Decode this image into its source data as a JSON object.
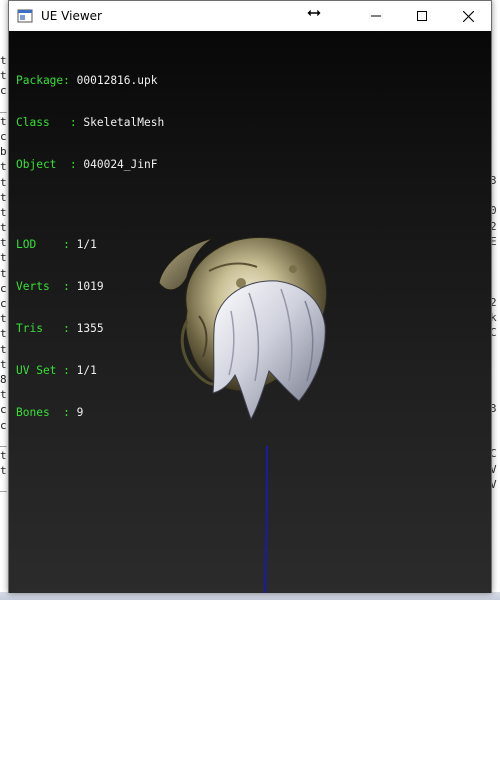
{
  "window": {
    "title": "UE Viewer"
  },
  "info": {
    "package_label": "Package",
    "package_value": "00012816.upk",
    "class_label": "Class",
    "class_value": "SkeletalMesh",
    "object_label": "Object",
    "object_value": "040024_JinF",
    "lod_label": "LOD",
    "lod_value": "1/1",
    "verts_label": "Verts",
    "verts_value": "1019",
    "tris_label": "Tris",
    "tris_value": "1355",
    "uvset_label": "UV Set",
    "uvset_value": "1/1",
    "bones_label": "Bones",
    "bones_value": "9"
  },
  "background_console": {
    "left_chars": [
      "t",
      "t",
      "c",
      "_",
      "t",
      "c",
      "b",
      "t",
      "t",
      "t",
      "t",
      "t",
      "t",
      "t",
      "t",
      "c",
      "c",
      "t",
      "t",
      "t",
      "t",
      "8",
      "t",
      "c",
      "c",
      "_",
      "t",
      "t",
      "_"
    ],
    "right_chars": [
      "3",
      "",
      "0",
      "2",
      "E",
      "",
      "",
      "",
      "2",
      "k",
      "C",
      "",
      "",
      "",
      "",
      "3",
      "",
      "",
      "C",
      "V",
      "V"
    ]
  },
  "colors": {
    "label": "#36e036",
    "value": "#f0f0f0",
    "viewport_top": "#080808",
    "viewport_bottom": "#2b2b2b",
    "bone_line": "#1a1aa8"
  }
}
